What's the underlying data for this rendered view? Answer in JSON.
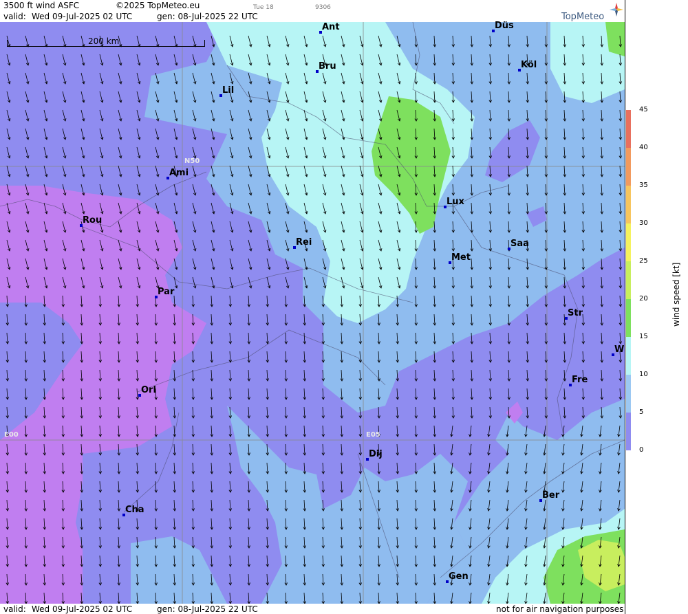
{
  "header": {
    "title": "3500 ft wind ASFC",
    "copyright": "©2025 TopMeteo.eu",
    "valid_prefix": "valid:",
    "valid_date": "Wed  09-Jul-2025  02 UTC",
    "generated": "gen: 08-Jul-2025 22 UTC",
    "small_day": "Tue 18",
    "small_code": "9306"
  },
  "logo": {
    "text": "TopMeteo",
    "icon": "compass-star-icon"
  },
  "scale": {
    "label": "200 km"
  },
  "grid_labels": {
    "lat": "N50",
    "lon1": "E00",
    "lon2": "E05"
  },
  "cities": [
    {
      "id": "ant",
      "name": "Ant"
    },
    {
      "id": "dus",
      "name": "Düs"
    },
    {
      "id": "bru",
      "name": "Bru"
    },
    {
      "id": "kol",
      "name": "Köl"
    },
    {
      "id": "lil",
      "name": "Lil"
    },
    {
      "id": "ami",
      "name": "Ami"
    },
    {
      "id": "lux",
      "name": "Lux"
    },
    {
      "id": "rou",
      "name": "Rou"
    },
    {
      "id": "rei",
      "name": "Rei"
    },
    {
      "id": "saa",
      "name": "Saa"
    },
    {
      "id": "met",
      "name": "Met"
    },
    {
      "id": "par",
      "name": "Par"
    },
    {
      "id": "str",
      "name": "Str"
    },
    {
      "id": "w",
      "name": "W"
    },
    {
      "id": "fre",
      "name": "Fre"
    },
    {
      "id": "orl",
      "name": "Orl"
    },
    {
      "id": "dij",
      "name": "Dij"
    },
    {
      "id": "ber",
      "name": "Ber"
    },
    {
      "id": "cha",
      "name": "Cha"
    },
    {
      "id": "gen",
      "name": "Gen"
    }
  ],
  "legend": {
    "title": "wind  speed  [kt]",
    "ticks": [
      "45",
      "40",
      "35",
      "30",
      "25",
      "20",
      "15",
      "10",
      "5",
      "0"
    ],
    "colors": [
      "#e8705e",
      "#f29a5e",
      "#f7c55e",
      "#f5f25e",
      "#c8ee5e",
      "#7ee05e",
      "#b7f5f5",
      "#9cc8f2",
      "#8f8cf0",
      "#c07ef0"
    ]
  },
  "footer": {
    "valid_prefix": "valid:",
    "valid_date": "Wed  09-Jul-2025  02 UTC",
    "generated": "gen: 08-Jul-2025 22 UTC",
    "disclaimer": "not for air navigation purposes"
  }
}
